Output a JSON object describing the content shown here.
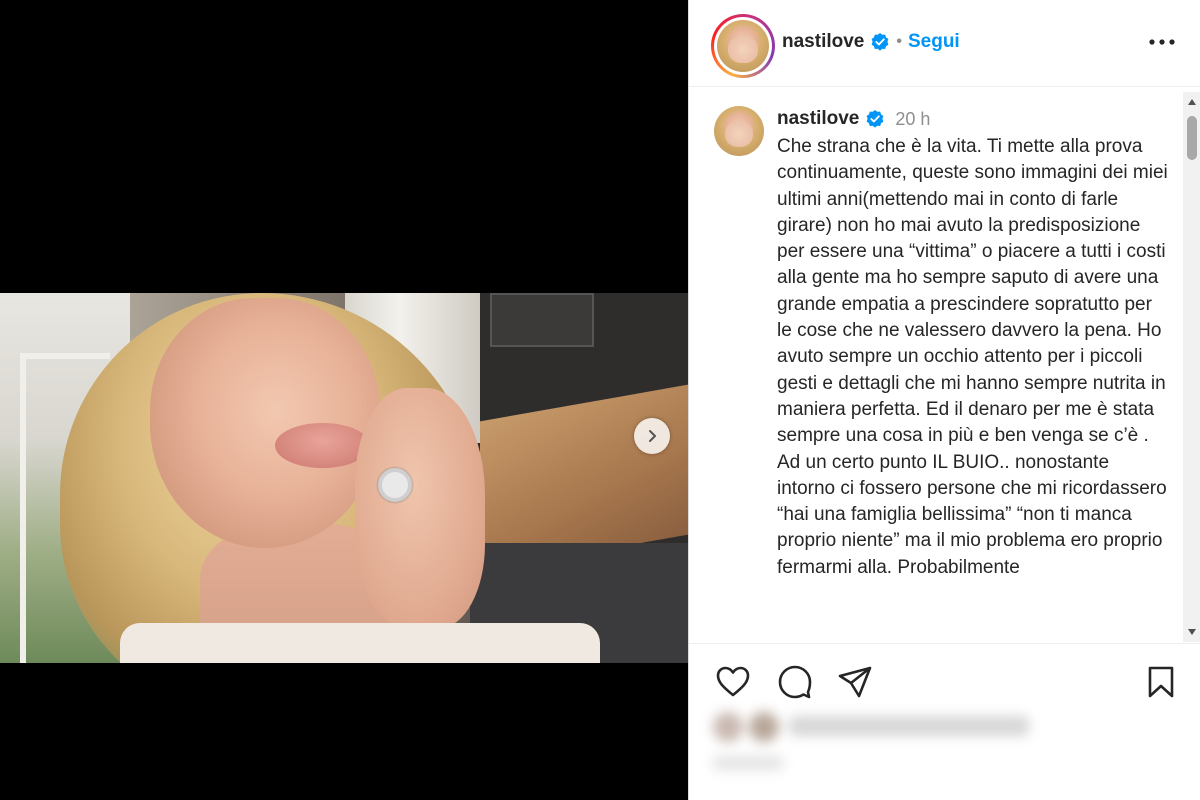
{
  "post": {
    "username": "nastilove",
    "verified": true,
    "follow_label": "Segui",
    "separator": "•",
    "time_ago": "20 h",
    "caption": "Che strana che è la vita. Ti mette alla prova continuamente, queste sono immagini dei miei ultimi anni(mettendo mai in conto di farle girare) non ho mai avuto la predisposizione per essere una “vittima” o piacere a tutti i costi alla gente ma ho sempre saputo di avere una grande empatia a prescindere sopratutto per le cose che ne valessero davvero la pena. Ho avuto sempre un occhio attento per i piccoli gesti e dettagli che mi hanno sempre nutrita in maniera perfetta. Ed il denaro per me è stata sempre una cosa in più e ben venga se c’è . Ad un certo punto IL BUIO.. nonostante intorno ci fossero persone che mi ricordassero “hai una famiglia bellissima” “non ti manca proprio niente” ma il mio problema ero proprio fermarmi alla. Probabilmente"
  },
  "icons": {
    "verified": "verified-badge-icon",
    "more": "more-options-icon",
    "next": "chevron-right-icon",
    "like": "heart-icon",
    "comment": "comment-bubble-icon",
    "share": "paper-plane-icon",
    "save": "bookmark-icon",
    "scroll_up": "triangle-up-icon",
    "scroll_down": "triangle-down-icon"
  },
  "colors": {
    "link": "#0095f6",
    "verified": "#0095f6",
    "text": "#262626",
    "muted": "#8e8e8e",
    "media_bg": "#000000"
  }
}
